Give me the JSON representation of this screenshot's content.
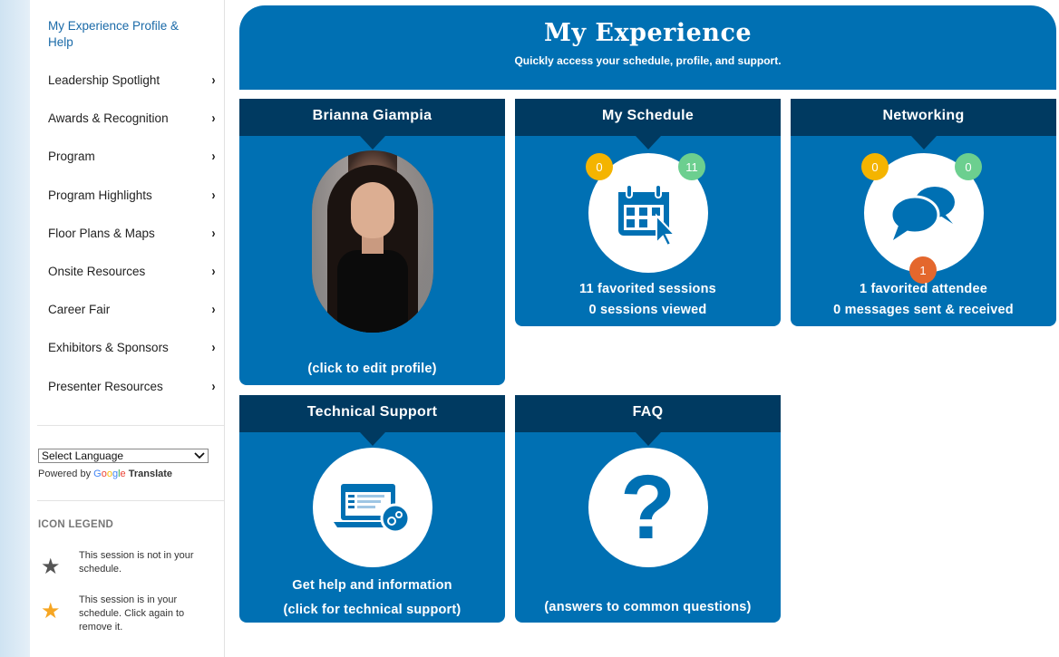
{
  "sidebar": {
    "top_link": "My Experience Profile & Help",
    "items": [
      {
        "label": "Leadership Spotlight"
      },
      {
        "label": "Awards & Recognition"
      },
      {
        "label": "Program"
      },
      {
        "label": "Program Highlights"
      },
      {
        "label": "Floor Plans & Maps"
      },
      {
        "label": "Onsite Resources"
      },
      {
        "label": "Career Fair"
      },
      {
        "label": "Exhibitors & Sponsors"
      },
      {
        "label": "Presenter Resources"
      }
    ],
    "chevron": "›",
    "language_select": "Select Language",
    "powered_by": "Powered by",
    "google_translate": "Translate",
    "icon_legend_title": "ICON LEGEND",
    "legend": [
      {
        "icon": "star-gray-icon",
        "text": "This session is not in your schedule."
      },
      {
        "icon": "star-orange-icon",
        "text": "This session is in your schedule. Click again to remove it."
      }
    ]
  },
  "header": {
    "title": "My Experience",
    "subtitle": "Quickly access your schedule, profile, and support."
  },
  "tiles": {
    "profile": {
      "title": "Brianna Giampia",
      "caption": "(click to edit profile)"
    },
    "schedule": {
      "title": "My Schedule",
      "badge_left": "0",
      "badge_right": "11",
      "line1": "11 favorited sessions",
      "line2": "0 sessions viewed"
    },
    "networking": {
      "title": "Networking",
      "badge_left": "0",
      "badge_right": "0",
      "badge_bottom": "1",
      "line1": "1 favorited attendee",
      "line2": "0 messages sent & received"
    },
    "support": {
      "title": "Technical Support",
      "line1": "Get help and information",
      "line2": "(click for technical support)"
    },
    "faq": {
      "title": "FAQ",
      "glyph": "?",
      "caption": "(answers to common questions)"
    }
  },
  "colors": {
    "primary": "#0070b3",
    "tile_header": "#003a61",
    "badge_yellow": "#f4b400",
    "badge_green": "#6ccf8f",
    "badge_orange": "#e4672d"
  }
}
